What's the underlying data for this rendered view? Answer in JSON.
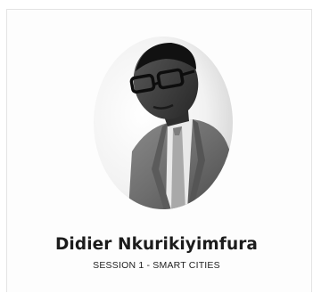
{
  "speaker": {
    "name": "Didier Nkurikiyimfura",
    "session": "SESSION 1 - SMART CITIES"
  },
  "colors": {
    "name_text": "#1c1c1c",
    "card_border": "#e4e4e4",
    "background": "#ffffff"
  },
  "icons": {
    "portrait": "speaker-portrait"
  }
}
